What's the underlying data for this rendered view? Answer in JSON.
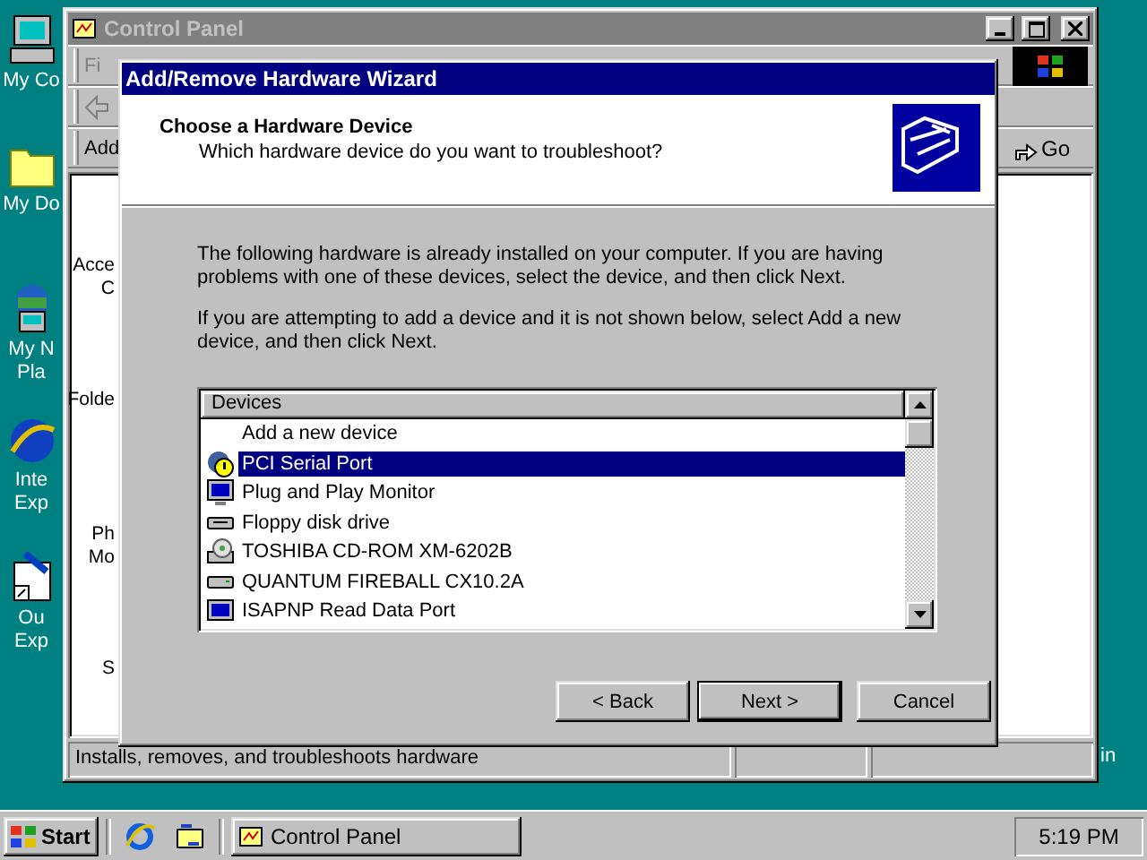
{
  "desktop": {
    "icons": [
      {
        "kind": "computer",
        "lines": [
          "My Co"
        ]
      },
      {
        "kind": "folder",
        "lines": [
          "My Do"
        ]
      },
      {
        "kind": "network",
        "lines": [
          "My N",
          "Pla"
        ]
      },
      {
        "kind": "globe",
        "lines": [
          "Inte",
          "Exp"
        ]
      },
      {
        "kind": "mail",
        "lines": [
          "Ou",
          "Exp"
        ]
      }
    ],
    "right_label": "in"
  },
  "control_panel": {
    "title": "Control Panel",
    "active": false,
    "menu": "Fi",
    "address_label": "Add",
    "go": "Go",
    "items": [
      {
        "lines": [
          "Acce",
          "C"
        ]
      },
      {
        "lines": [
          "Folde"
        ]
      },
      {
        "lines": [
          "Ph",
          "Mo"
        ]
      },
      {
        "lines": [
          "S"
        ]
      }
    ],
    "status_bar": "Installs, removes, and troubleshoots hardware"
  },
  "wizard": {
    "title": "Add/Remove Hardware Wizard",
    "active": true,
    "heading": "Choose a Hardware Device",
    "subtitle": "Which hardware device do you want to troubleshoot?",
    "paragraphs": [
      "The following hardware is already installed on your computer. If you are having problems with one of these devices, select the device, and then click Next.",
      "If you are attempting to add a device and it is not shown below, select Add a new device, and then click Next."
    ],
    "list": {
      "column": "Devices",
      "items": [
        {
          "label": "Add a new device",
          "kind": "none",
          "selected": false
        },
        {
          "label": "PCI Serial Port",
          "kind": "warning",
          "selected": true
        },
        {
          "label": "Plug and Play Monitor",
          "kind": "monitor",
          "selected": false
        },
        {
          "label": "Floppy disk drive",
          "kind": "floppy",
          "selected": false
        },
        {
          "label": "TOSHIBA CD-ROM XM-6202B",
          "kind": "cdrom",
          "selected": false
        },
        {
          "label": "QUANTUM FIREBALL CX10.2A",
          "kind": "harddisk",
          "selected": false
        },
        {
          "label": "ISAPNP Read Data Port",
          "kind": "chip",
          "selected": false
        }
      ]
    },
    "buttons": [
      {
        "label": "< Back",
        "default": false
      },
      {
        "label": "Next >",
        "default": true
      },
      {
        "label": "Cancel",
        "default": false
      }
    ]
  },
  "taskbar": {
    "start": "Start",
    "tasks": [
      {
        "label": "Control Panel",
        "selected": false
      }
    ],
    "clock": "5:19 PM"
  }
}
